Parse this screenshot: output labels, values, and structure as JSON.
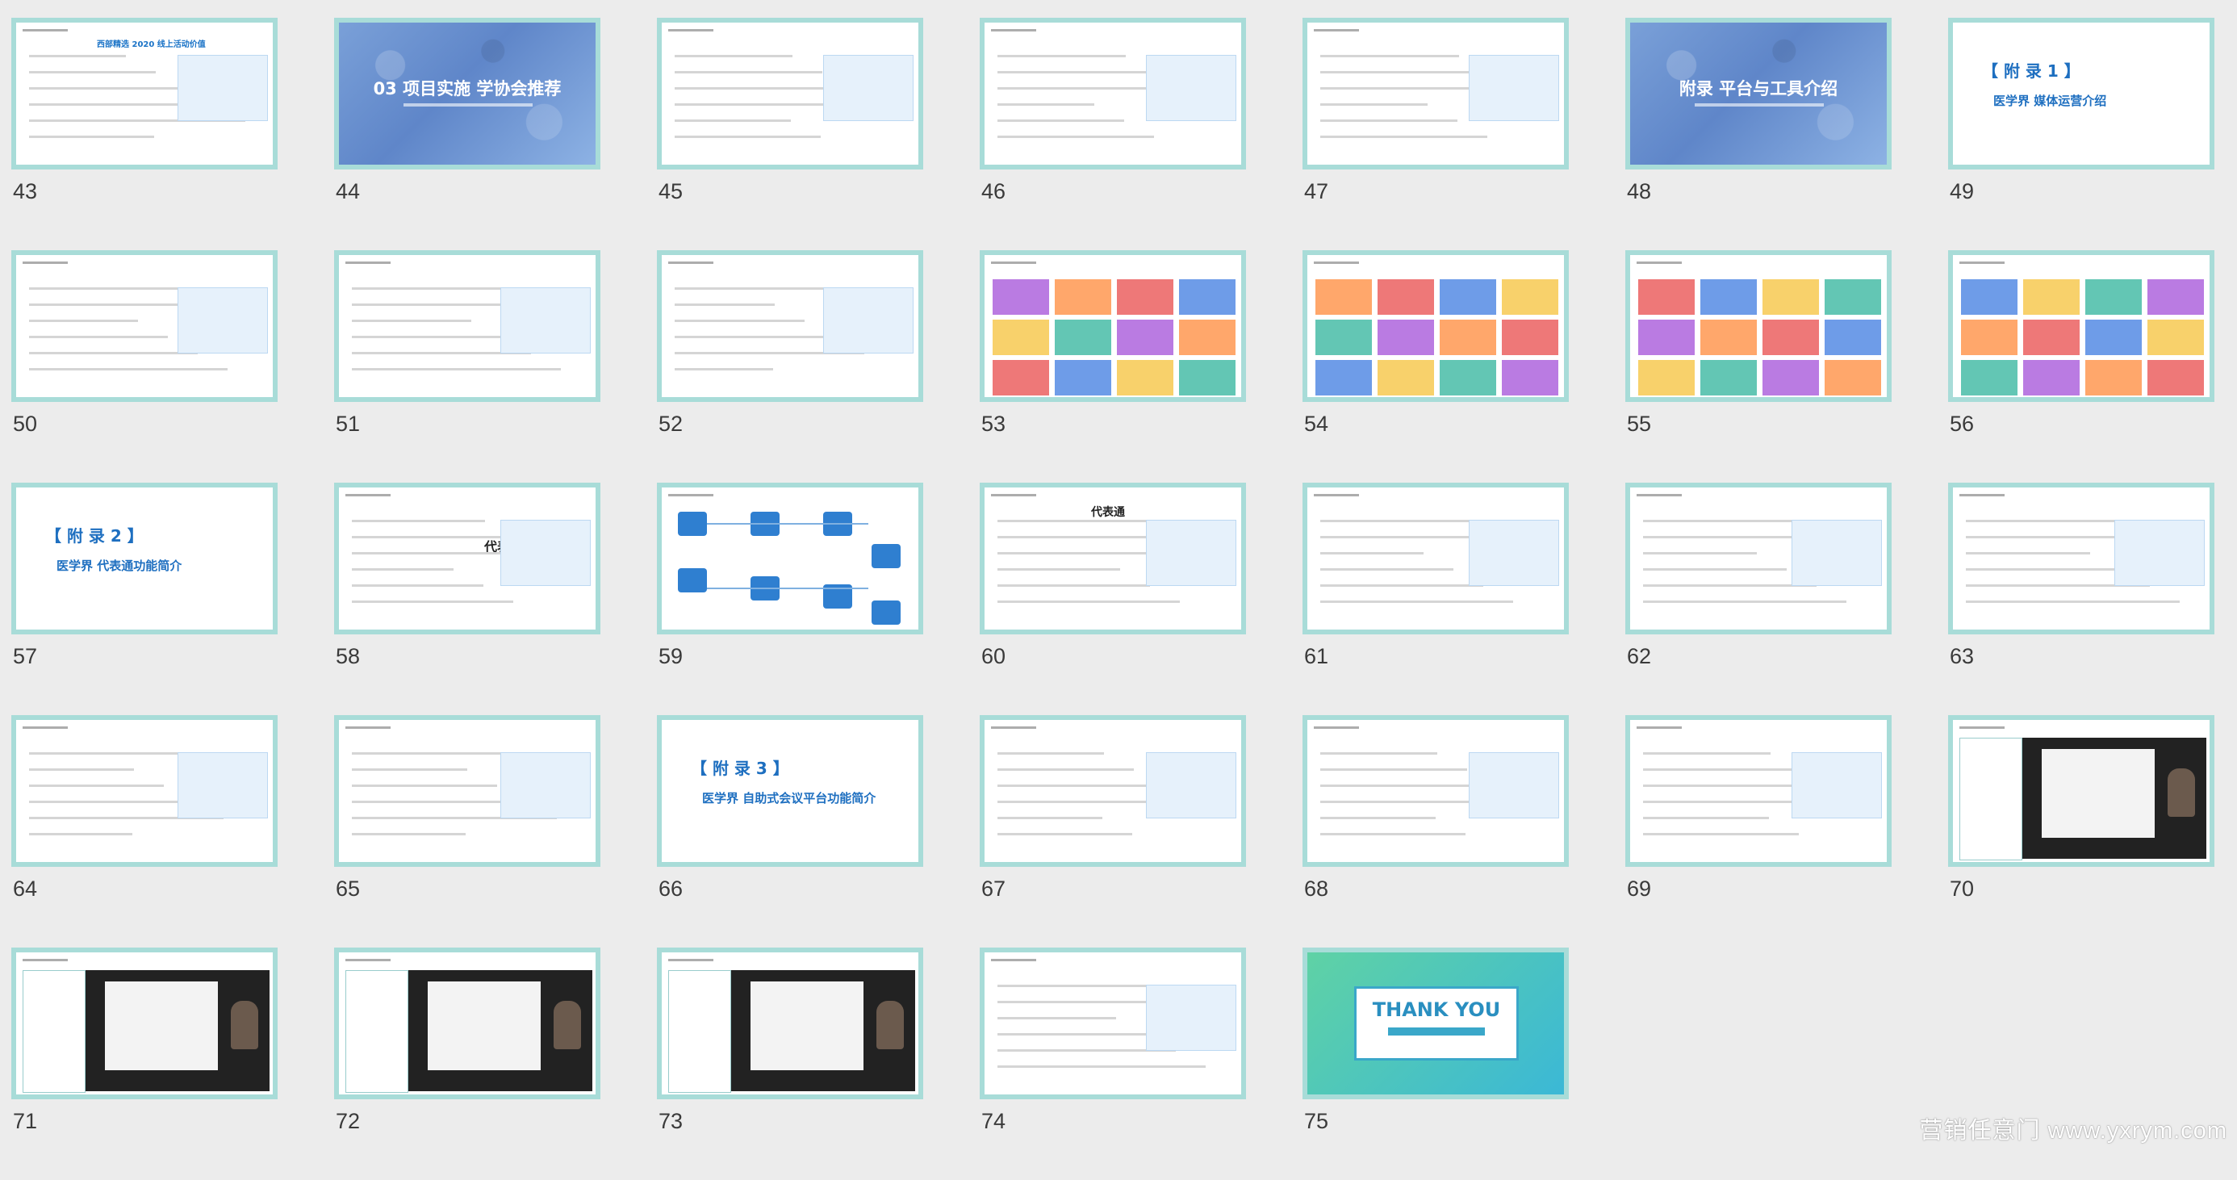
{
  "slides": [
    {
      "num": "43",
      "kind": "text",
      "title": "西部精选 2020 线上活动价值"
    },
    {
      "num": "44",
      "kind": "photo",
      "title": "03 项目实施 学协会推荐"
    },
    {
      "num": "45",
      "kind": "text"
    },
    {
      "num": "46",
      "kind": "text"
    },
    {
      "num": "47",
      "kind": "text"
    },
    {
      "num": "48",
      "kind": "photo",
      "title": "附录 平台与工具介绍"
    },
    {
      "num": "49",
      "kind": "appendix",
      "label": "【 附 录 1 】",
      "sub": "医学界 媒体运营介绍"
    },
    {
      "num": "50",
      "kind": "text"
    },
    {
      "num": "51",
      "kind": "text"
    },
    {
      "num": "52",
      "kind": "text"
    },
    {
      "num": "53",
      "kind": "collage"
    },
    {
      "num": "54",
      "kind": "collage"
    },
    {
      "num": "55",
      "kind": "collage"
    },
    {
      "num": "56",
      "kind": "collage"
    },
    {
      "num": "57",
      "kind": "appendix",
      "label": "【 附 录 2 】",
      "sub": "医学界 代表通功能简介"
    },
    {
      "num": "58",
      "kind": "text",
      "title": "代表通"
    },
    {
      "num": "59",
      "kind": "diagram"
    },
    {
      "num": "60",
      "kind": "text",
      "title": "代表通"
    },
    {
      "num": "61",
      "kind": "text"
    },
    {
      "num": "62",
      "kind": "text"
    },
    {
      "num": "63",
      "kind": "text"
    },
    {
      "num": "64",
      "kind": "text"
    },
    {
      "num": "65",
      "kind": "text"
    },
    {
      "num": "66",
      "kind": "appendix",
      "label": "【 附 录 3 】",
      "sub": "医学界 自助式会议平台功能简介"
    },
    {
      "num": "67",
      "kind": "text"
    },
    {
      "num": "68",
      "kind": "text"
    },
    {
      "num": "69",
      "kind": "text"
    },
    {
      "num": "70",
      "kind": "video"
    },
    {
      "num": "71",
      "kind": "video"
    },
    {
      "num": "72",
      "kind": "video"
    },
    {
      "num": "73",
      "kind": "video"
    },
    {
      "num": "74",
      "kind": "text"
    },
    {
      "num": "75",
      "kind": "thanks",
      "title": "THANK YOU"
    }
  ],
  "watermark": "营销任意门 www.yxrym.com",
  "colors": {
    "border": "#a8dcd8",
    "accent": "#1a73c7",
    "background": "#ececec"
  }
}
